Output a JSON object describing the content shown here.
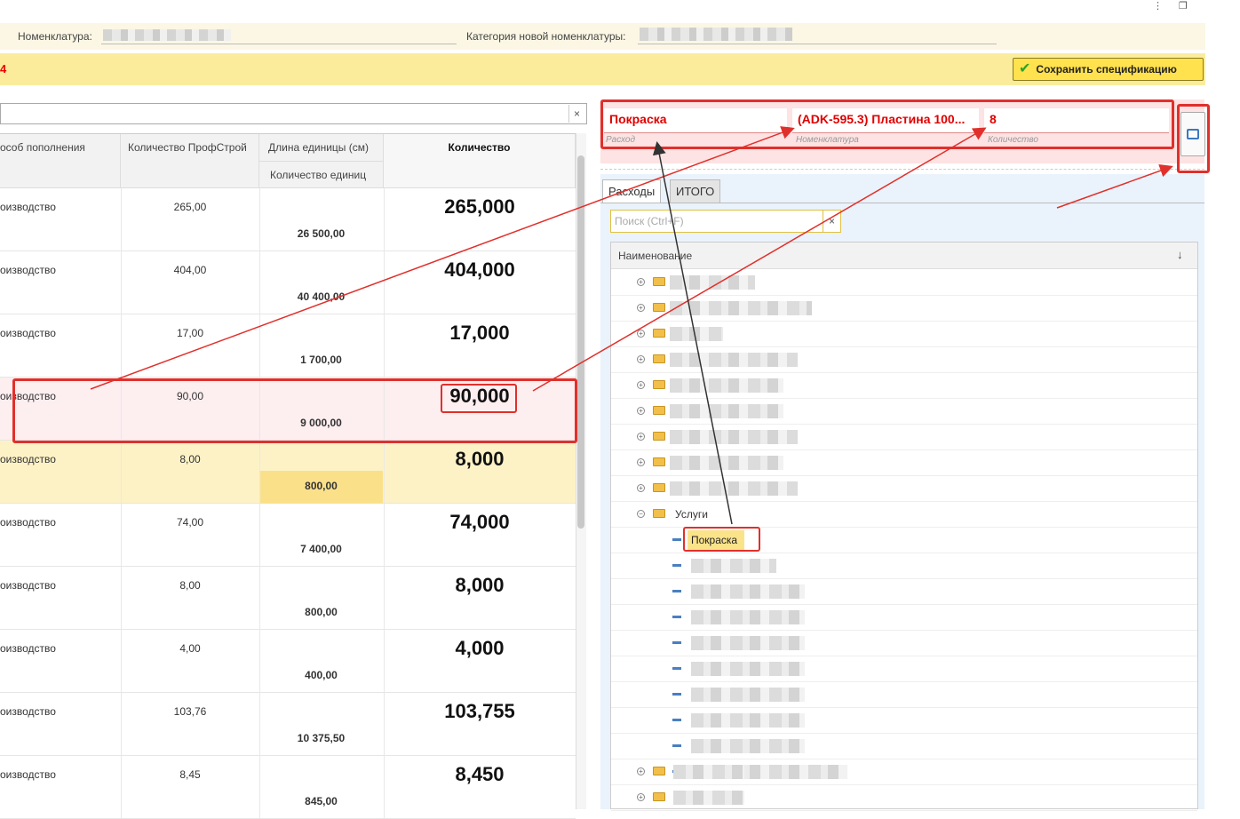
{
  "window": {
    "menu_icon": "⋮",
    "restore_icon": "❐"
  },
  "header": {
    "nomenclature_label": "Номенклатура:",
    "category_label": "Категория новой номенклатуры:"
  },
  "toolbar": {
    "left_mark": "4",
    "save_label": "Сохранить спецификацию"
  },
  "left_search": {
    "clear": "×"
  },
  "table": {
    "columns": {
      "mode": "особ пополнения",
      "pq": "Количество ПрофСтрой",
      "unit_len": "Длина единицы (см)",
      "unit_cnt": "Количество единиц",
      "qty": "Количество"
    },
    "rows": [
      {
        "mode": "оизводство",
        "pq": "265,00",
        "cnt": "26 500,00",
        "qty": "265,000"
      },
      {
        "mode": "оизводство",
        "pq": "404,00",
        "cnt": "40 400,00",
        "qty": "404,000"
      },
      {
        "mode": "оизводство",
        "pq": "17,00",
        "cnt": "1 700,00",
        "qty": "17,000"
      },
      {
        "mode": "оизводство",
        "pq": "90,00",
        "cnt": "9 000,00",
        "qty": "90,000"
      },
      {
        "mode": "оизводство",
        "pq": "8,00",
        "cnt": "800,00",
        "qty": "8,000"
      },
      {
        "mode": "оизводство",
        "pq": "74,00",
        "cnt": "7 400,00",
        "qty": "74,000"
      },
      {
        "mode": "оизводство",
        "pq": "8,00",
        "cnt": "800,00",
        "qty": "8,000"
      },
      {
        "mode": "оизводство",
        "pq": "4,00",
        "cnt": "400,00",
        "qty": "4,000"
      },
      {
        "mode": "оизводство",
        "pq": "103,76",
        "cnt": "10 375,50",
        "qty": "103,755"
      },
      {
        "mode": "оизводство",
        "pq": "8,45",
        "cnt": "845,00",
        "qty": "8,450"
      }
    ]
  },
  "right": {
    "expense_value": "Покраска",
    "expense_label": "Расход",
    "nomenclature_value": "(ADK-595.3) Пластина 100...",
    "nomenclature_label": "Номенклатура",
    "quantity_value": "8",
    "quantity_label": "Количество",
    "tabs": [
      "Расходы",
      "ИТОГО"
    ],
    "search_placeholder": "Поиск (Ctrl+F)",
    "search_clear": "×",
    "tree_header": "Наименование",
    "sort_icon": "↓",
    "group_services": "Услуги",
    "selected_item": "Покраска"
  },
  "colors": {
    "accent_red": "#e0302c",
    "save_yellow": "#ffe24d",
    "highlight_pink": "#fde3e3"
  }
}
